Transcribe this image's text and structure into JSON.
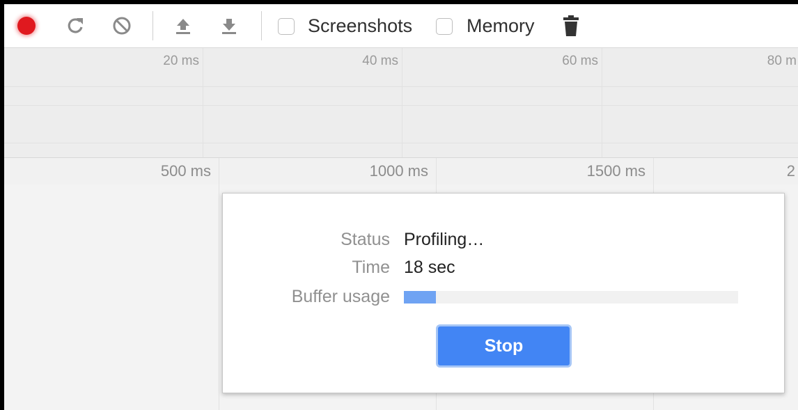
{
  "toolbar": {
    "record_icon": "record-icon",
    "reload_icon": "reload-icon",
    "clear_icon": "clear-icon",
    "load_icon": "upload-icon",
    "save_icon": "download-icon",
    "trash_icon": "trash-icon",
    "screenshots_label": "Screenshots",
    "screenshots_checked": false,
    "memory_label": "Memory",
    "memory_checked": false,
    "record_color": "#e0191f"
  },
  "overview": {
    "ticks": [
      "20 ms",
      "40 ms",
      "60 ms",
      "80 m"
    ]
  },
  "timeline": {
    "ticks": [
      "500 ms",
      "1000 ms",
      "1500 ms",
      "2"
    ]
  },
  "dialog": {
    "status_label": "Status",
    "status_value": "Profiling…",
    "time_label": "Time",
    "time_value": "18 sec",
    "buffer_label": "Buffer usage",
    "buffer_fraction": 0.095,
    "stop_label": "Stop",
    "accent_color": "#4285f4"
  }
}
